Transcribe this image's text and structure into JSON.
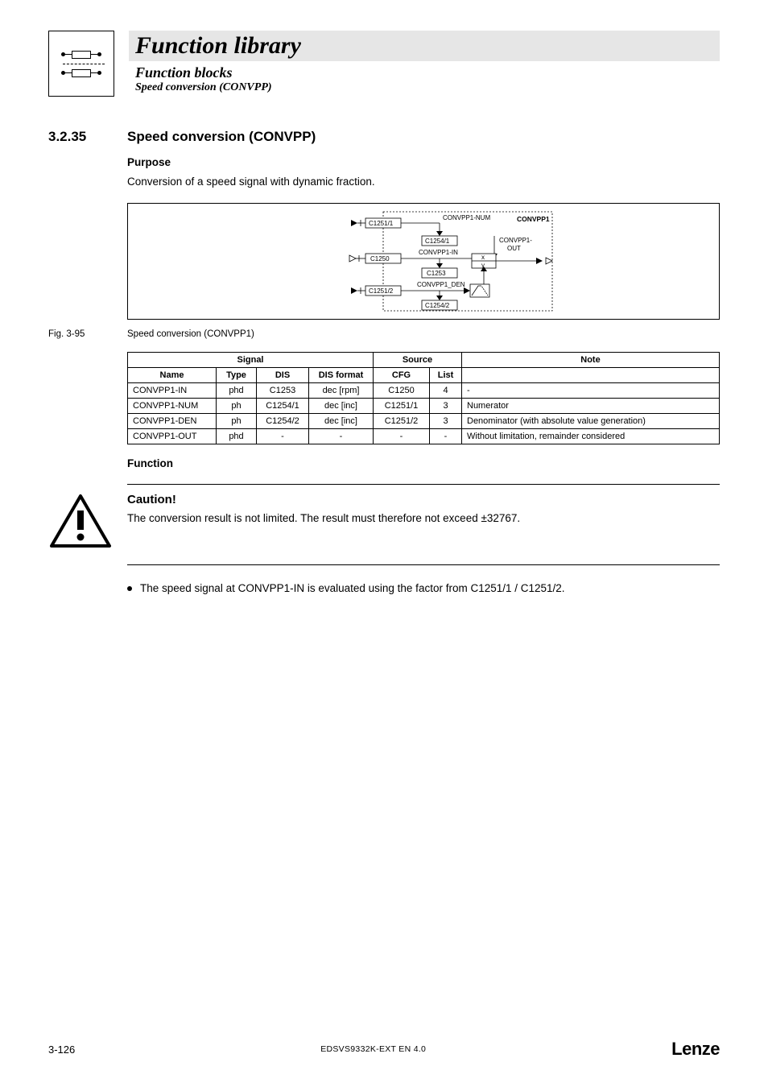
{
  "header": {
    "title": "Function library",
    "subtitle1": "Function blocks",
    "subtitle2": "Speed conversion (CONVPP)"
  },
  "section": {
    "number": "3.2.35",
    "title": "Speed conversion (CONVPP)"
  },
  "purpose": {
    "heading": "Purpose",
    "text": "Conversion of a speed signal with dynamic fraction."
  },
  "diagram": {
    "block_name": "CONVPP1",
    "labels": {
      "num": "CONVPP1-NUM",
      "in": "CONVPP1-IN",
      "den": "CONVPP1_DEN",
      "out_top": "CONVPP1-",
      "out_bot": "OUT",
      "x": "x",
      "y": "y"
    },
    "codes": {
      "c1251_1": "C1251/1",
      "c1254_1": "C1254/1",
      "c1250": "C1250",
      "c1253": "C1253",
      "c1251_2": "C1251/2",
      "c1254_2": "C1254/2"
    }
  },
  "figure": {
    "label": "Fig. 3-95",
    "caption": "Speed conversion (CONVPP1)"
  },
  "table": {
    "group_headers": {
      "signal": "Signal",
      "source": "Source",
      "note": "Note"
    },
    "headers": {
      "name": "Name",
      "type": "Type",
      "dis": "DIS",
      "dis_format": "DIS format",
      "cfg": "CFG",
      "list": "List"
    },
    "rows": [
      {
        "name": "CONVPP1-IN",
        "type": "phd",
        "dis": "C1253",
        "dis_format": "dec [rpm]",
        "cfg": "C1250",
        "list": "4",
        "note": "-"
      },
      {
        "name": "CONVPP1-NUM",
        "type": "ph",
        "dis": "C1254/1",
        "dis_format": "dec [inc]",
        "cfg": "C1251/1",
        "list": "3",
        "note": "Numerator"
      },
      {
        "name": "CONVPP1-DEN",
        "type": "ph",
        "dis": "C1254/2",
        "dis_format": "dec [inc]",
        "cfg": "C1251/2",
        "list": "3",
        "note": "Denominator (with absolute value generation)"
      },
      {
        "name": "CONVPP1-OUT",
        "type": "phd",
        "dis": "-",
        "dis_format": "-",
        "cfg": "-",
        "list": "-",
        "note": "Without limitation, remainder considered"
      }
    ]
  },
  "function_heading": "Function",
  "caution": {
    "title": "Caution!",
    "text": "The conversion result is not limited. The result must therefore not exceed ±32767."
  },
  "bullet": "The speed signal at CONVPP1-IN is evaluated using the factor from C1251/1 / C1251/2.",
  "footer": {
    "page": "3-126",
    "doc": "EDSVS9332K-EXT EN 4.0",
    "brand": "Lenze"
  }
}
